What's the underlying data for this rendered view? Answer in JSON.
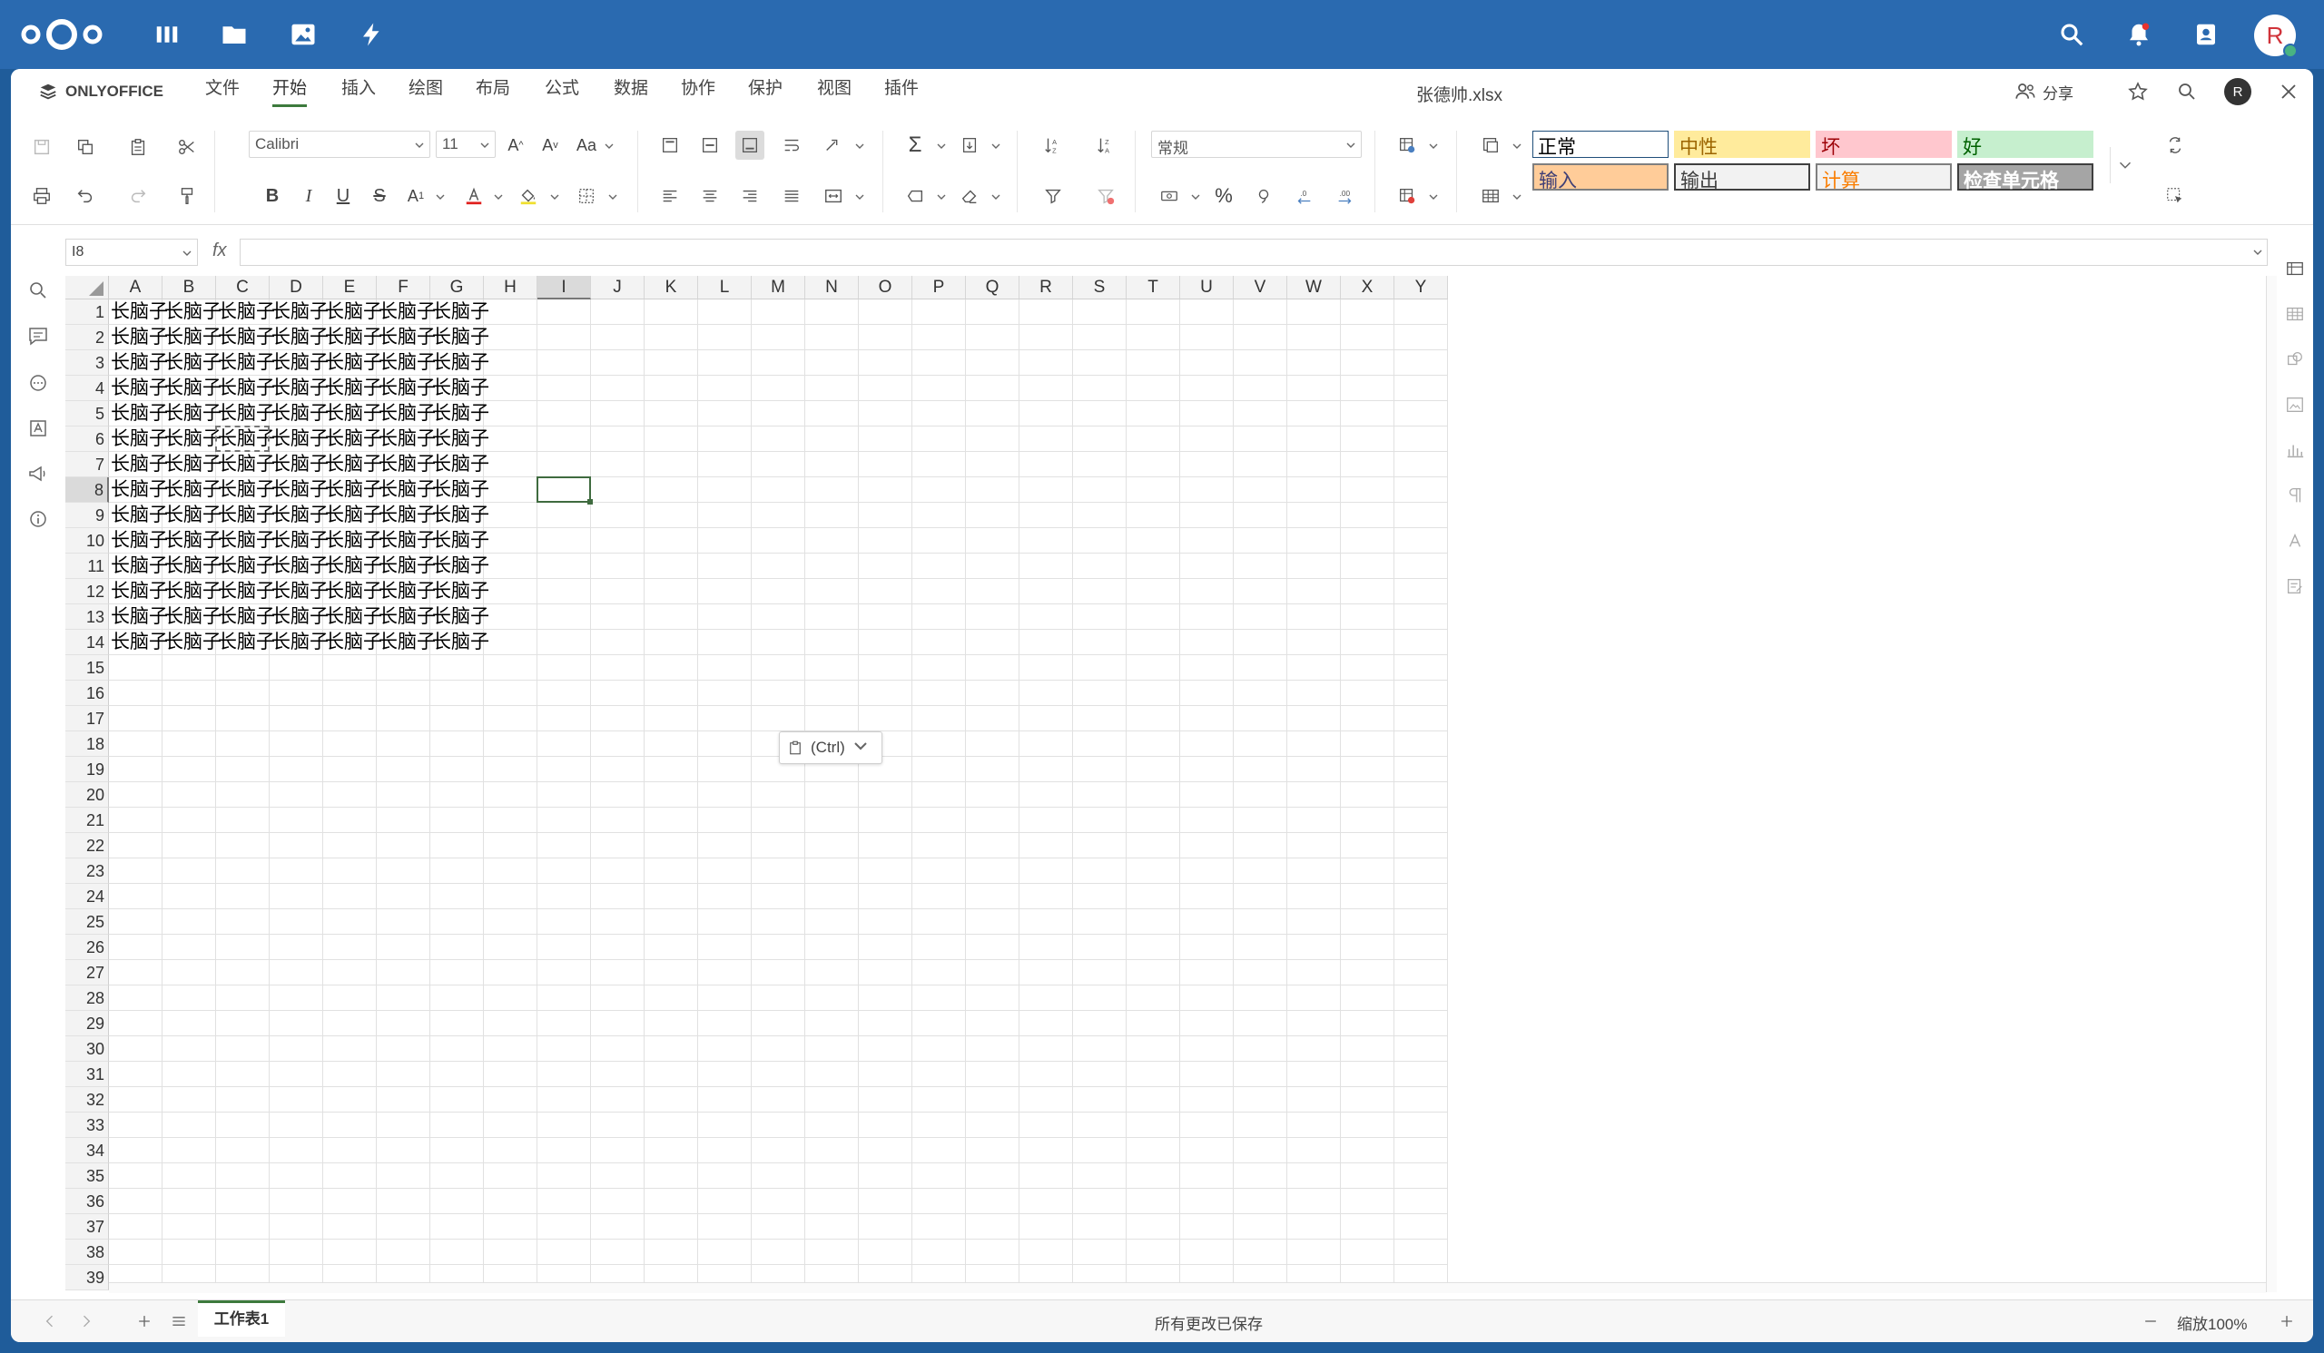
{
  "topbar": {
    "apps": [
      "dashboard",
      "files",
      "photos",
      "activity"
    ],
    "avatar_letter": "R"
  },
  "menu": {
    "logo_text": "ONLYOFFICE",
    "tabs": [
      "文件",
      "开始",
      "插入",
      "绘图",
      "布局",
      "公式",
      "数据",
      "协作",
      "保护",
      "视图",
      "插件"
    ],
    "active_tab": "开始",
    "doc_title": "张德帅.xlsx",
    "share_label": "分享",
    "user_letter": "R"
  },
  "toolbar": {
    "font_name": "Calibri",
    "font_size": "11",
    "number_format": "常规"
  },
  "styles": {
    "row1": [
      {
        "label": "正常",
        "bg": "#ffffff",
        "color": "#000000",
        "border": "#1f4e79"
      },
      {
        "label": "中性",
        "bg": "#ffeb9c",
        "color": "#9c6500",
        "border": "#ffeb9c"
      },
      {
        "label": "坏",
        "bg": "#ffc7ce",
        "color": "#9c0006",
        "border": "#ffc7ce"
      },
      {
        "label": "好",
        "bg": "#c6efce",
        "color": "#006100",
        "border": "#c6efce"
      }
    ],
    "row2": [
      {
        "label": "输入",
        "bg": "#ffcc99",
        "color": "#3f3f76",
        "border": "#7f7f7f"
      },
      {
        "label": "输出",
        "bg": "#f2f2f2",
        "color": "#3f3f3f",
        "border": "#3f3f3f"
      },
      {
        "label": "计算",
        "bg": "#f2f2f2",
        "color": "#fa7d00",
        "border": "#7f7f7f"
      },
      {
        "label": "检查单元格",
        "bg": "#a5a5a5",
        "color": "#ffffff",
        "border": "#3f3f3f"
      }
    ]
  },
  "formula": {
    "name_box": "I8",
    "fx_label": "fx",
    "content": ""
  },
  "grid": {
    "columns": [
      "A",
      "B",
      "C",
      "D",
      "E",
      "F",
      "G",
      "H",
      "I",
      "J",
      "K",
      "L",
      "M",
      "N",
      "O",
      "P",
      "Q",
      "R",
      "S",
      "T",
      "U",
      "V",
      "W",
      "X",
      "Y"
    ],
    "row_count": 39,
    "selected_column": "I",
    "selected_row": 8,
    "filled_columns": [
      "A",
      "B",
      "C",
      "D",
      "E",
      "F",
      "G"
    ],
    "filled_rows": 14,
    "cell_value": "长脑子",
    "copy_marquee_cell": "C6"
  },
  "paste_options": {
    "label": "(Ctrl)"
  },
  "statusbar": {
    "sheet_name": "工作表1",
    "save_status": "所有更改已保存",
    "zoom_label": "缩放100%"
  }
}
